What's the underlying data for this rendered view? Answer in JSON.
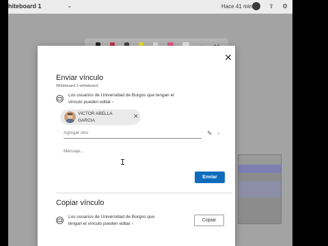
{
  "header": {
    "title": "hiteboard 1",
    "title_chevron": "chevron-down-icon",
    "updated": "Hace 41 min"
  },
  "dialog": {
    "title": "Enviar vínculo",
    "subtitle": "Whiteboard 1.whiteboard",
    "permission_line1": "Los usuarios de Universidad de Burgos que tengan el",
    "permission_line2": "vínculo pueden editar",
    "permission_chevron": "›",
    "recipient": {
      "name_line1": "VICTOR ABELLA",
      "name_line2": "GARCIA",
      "remove": "✕"
    },
    "add_placeholder": "Agregar otro",
    "message_placeholder": "Mensaje...",
    "send_label": "Enviar",
    "close": "✕"
  },
  "copy_section": {
    "title": "Copiar vínculo",
    "permission_line1": "Los usuarios de Universidad de Burgos que",
    "permission_line2": "tengan el vínculo pueden editar",
    "permission_chevron": "›",
    "copy_label": "Copiar"
  },
  "colors": {
    "accent": "#0f6cbd",
    "overlay": "#a3a3a3"
  },
  "toolbar_tools": [
    "pen-black",
    "pen-red",
    "pen-dark",
    "highlighter-yellow",
    "highlighter-light",
    "highlighter-pink",
    "eraser",
    "lasso-icon",
    "close-icon"
  ]
}
